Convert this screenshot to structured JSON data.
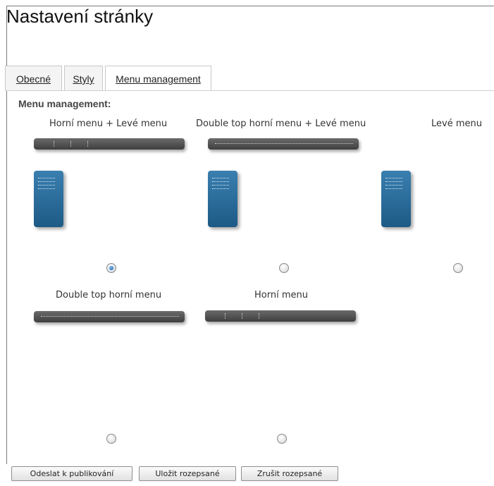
{
  "page": {
    "title": "Nastavení stránky"
  },
  "tabs": [
    {
      "label": "Obecné",
      "active": false
    },
    {
      "label": "Styly",
      "active": false
    },
    {
      "label": "Menu management",
      "active": true
    }
  ],
  "menu_management": {
    "section_label": "Menu management:",
    "options": [
      {
        "label": "Horní menu + Levé menu",
        "selected": true
      },
      {
        "label": "Double top horní menu + Levé menu",
        "selected": false
      },
      {
        "label": "Levé menu",
        "selected": false
      },
      {
        "label": "Double top horní menu",
        "selected": false
      },
      {
        "label": "Horní menu",
        "selected": false
      }
    ]
  },
  "buttons": {
    "publish": "Odeslat k publikování",
    "save_draft": "Uložit rozepsané",
    "cancel_draft": "Zrušit rozepsané"
  },
  "colors": {
    "menu_bar": "#4a4a4a",
    "side_menu": "#2a6a98",
    "tab_border": "#c8c8c8"
  }
}
